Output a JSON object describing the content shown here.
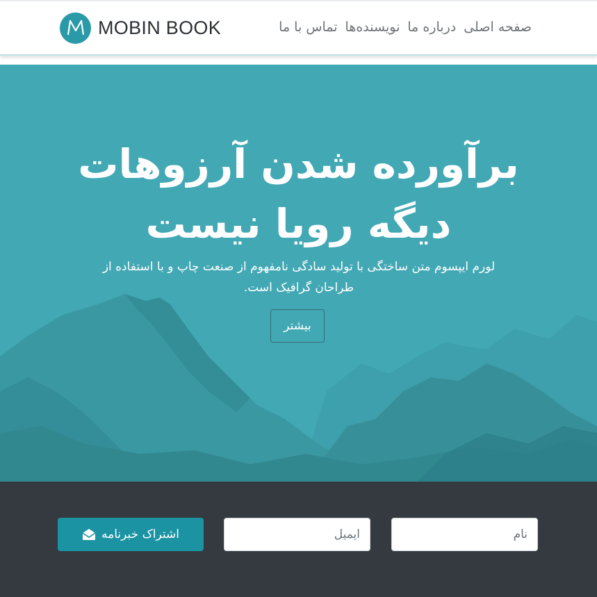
{
  "brand": {
    "logo_letter": "M",
    "name": "MOBIN BOOK"
  },
  "nav": {
    "items": [
      {
        "label": "صفحه اصلی"
      },
      {
        "label": "درباره ما"
      },
      {
        "label": "نویسنده‌ها"
      },
      {
        "label": "تماس با ما"
      }
    ]
  },
  "hero": {
    "title_line1": "برآورده شدن آرزوهات",
    "title_line2": "دیگه رویا نیست",
    "subtitle_line1": "لورم ایپسوم متن ساختگی با تولید سادگی نامفهوم از صنعت چاپ و با استفاده از",
    "subtitle_line2": "طراحان گرافیک است.",
    "button_label": "بیشتر"
  },
  "newsletter": {
    "name_placeholder": "نام",
    "email_placeholder": "ایمیل",
    "subscribe_label": "اشتراک خبرنامه",
    "subscribe_icon": "envelope-open-icon"
  },
  "colors": {
    "brand_accent": "#2b9aa8",
    "hero_background": "#42a8b4",
    "newsletter_background": "#343a40",
    "subscribe_button": "#1b93a3"
  }
}
